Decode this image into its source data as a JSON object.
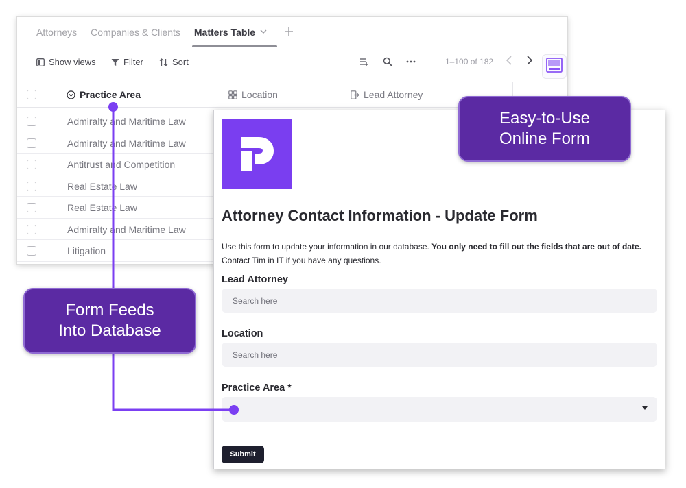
{
  "database": {
    "tabs": [
      {
        "label": "Attorneys"
      },
      {
        "label": "Companies & Clients"
      },
      {
        "label": "Matters Table"
      }
    ],
    "active_tab": "Matters Table",
    "toolbar": {
      "show_views": "Show views",
      "filter": "Filter",
      "sort": "Sort",
      "pagination": "1–100 of 182"
    },
    "columns": [
      {
        "label": "Practice Area",
        "icon": "dropdown-circle-icon"
      },
      {
        "label": "Location",
        "icon": "grid-icon"
      },
      {
        "label": "Lead Attorney",
        "icon": "link-icon"
      }
    ],
    "rows": [
      {
        "practice_area": "Admiralty and Maritime Law"
      },
      {
        "practice_area": "Admiralty and Maritime Law"
      },
      {
        "practice_area": "Antitrust and Competition"
      },
      {
        "practice_area": "Real Estate Law"
      },
      {
        "practice_area": "Real Estate Law"
      },
      {
        "practice_area": "Admiralty and Maritime Law"
      },
      {
        "practice_area": "Litigation"
      }
    ]
  },
  "form": {
    "title": "Attorney Contact Information - Update Form",
    "description_prefix": "Use this form to update your information in our database. ",
    "description_bold": "You only need to fill out the fields that are out of date.",
    "description_suffix": " Contact Tim in IT if you have any questions.",
    "fields": {
      "lead_attorney": {
        "label": "Lead Attorney",
        "placeholder": "Search here"
      },
      "location": {
        "label": "Location",
        "placeholder": "Search here"
      },
      "practice_area": {
        "label": "Practice Area",
        "required_mark": "*",
        "value": ""
      }
    },
    "submit_label": "Submit"
  },
  "callouts": {
    "form_line1": "Easy-to-Use",
    "form_line2": "Online Form",
    "db_line1": "Form Feeds",
    "db_line2": "Into Database"
  },
  "colors": {
    "brand_purple": "#7a3ef0",
    "callout_purple": "#5b2aa3",
    "connector": "#7b3ff2",
    "submit_dark": "#1e1f2e"
  }
}
